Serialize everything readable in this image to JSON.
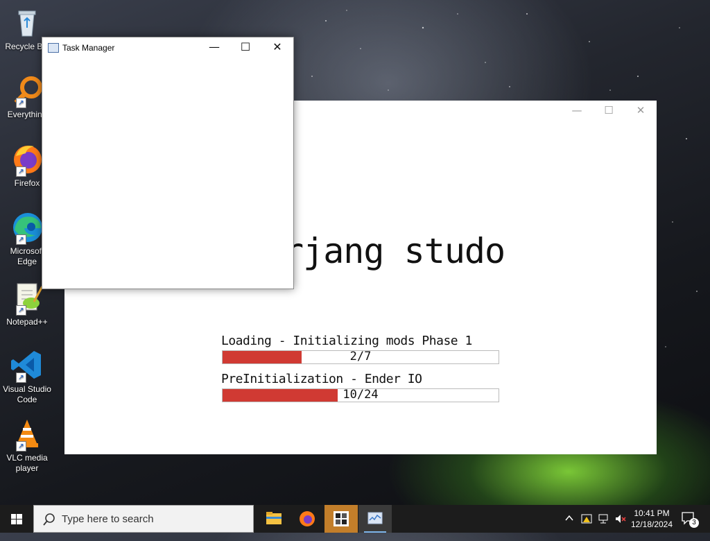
{
  "desktop": {
    "icons": [
      {
        "label": "Recycle Bin",
        "icon": "recycle-bin-icon"
      },
      {
        "label": "Everything",
        "icon": "everything-search-icon"
      },
      {
        "label": "Firefox",
        "icon": "firefox-icon"
      },
      {
        "label": "Microsoft Edge",
        "icon": "edge-icon"
      },
      {
        "label": "Notepad++",
        "icon": "notepadpp-icon"
      },
      {
        "label": "Visual Studio Code",
        "icon": "vscode-icon"
      },
      {
        "label": "VLC media player",
        "icon": "vlc-icon"
      }
    ]
  },
  "game_window": {
    "title_text": "rjang studo",
    "progress": [
      {
        "label": "Loading - Initializing mods Phase 1",
        "text": "2/7",
        "fraction": 0.2857
      },
      {
        "label": "PreInitialization - Ender IO",
        "text": "10/24",
        "fraction": 0.4167
      }
    ],
    "controls": {
      "minimize": "—",
      "maximize": "☐",
      "close": "✕"
    }
  },
  "task_manager": {
    "title": "Task Manager",
    "controls": {
      "minimize": "—",
      "maximize": "☐",
      "close": "✕"
    }
  },
  "taskbar": {
    "search_placeholder": "Type here to search",
    "pinned": [
      "file-explorer-icon",
      "firefox-icon",
      "game-app-icon",
      "task-manager-icon"
    ],
    "clock_time": "10:41 PM",
    "clock_date": "12/18/2024",
    "notification_count": "3"
  },
  "colors": {
    "progress_fill": "#d03a33",
    "taskbar": "#1c1c1c",
    "active_button": "#c27e2a"
  }
}
